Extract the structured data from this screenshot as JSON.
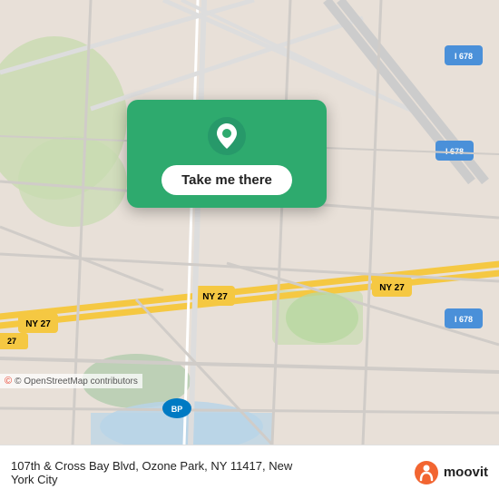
{
  "map": {
    "background_color": "#e8e0d8",
    "attribution": "© OpenStreetMap contributors"
  },
  "card": {
    "button_label": "Take me there",
    "bg_color": "#2eaa6e"
  },
  "bottom_bar": {
    "address_line1": "107th & Cross Bay Blvd, Ozone Park, NY 11417, New",
    "address_line2": "York City",
    "logo_text": "moovit"
  }
}
